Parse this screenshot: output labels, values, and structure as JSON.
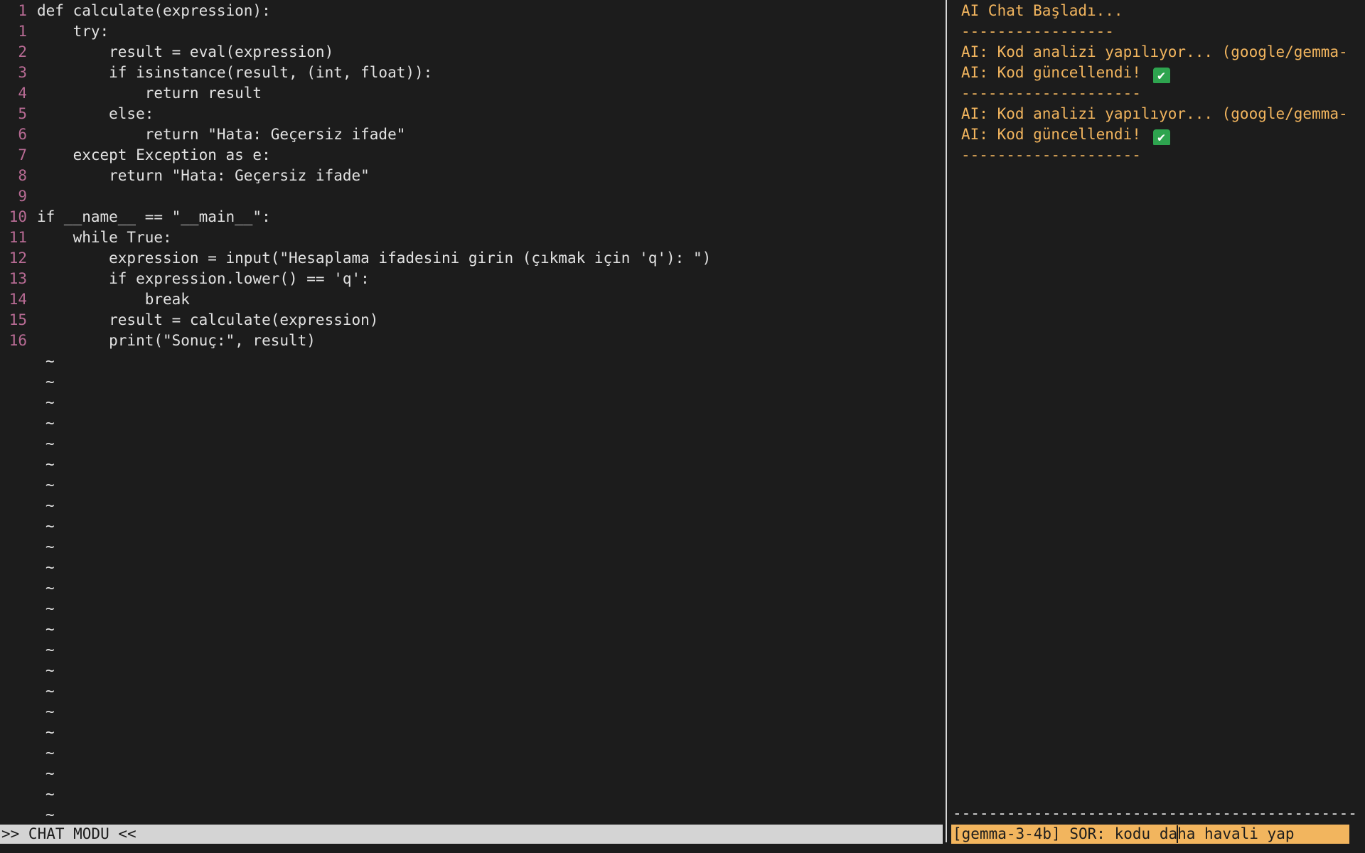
{
  "editor": {
    "lines": [
      {
        "num": "1",
        "code": "def calculate(expression):"
      },
      {
        "num": "1",
        "code": "    try:"
      },
      {
        "num": "2",
        "code": "        result = eval(expression)"
      },
      {
        "num": "3",
        "code": "        if isinstance(result, (int, float)):"
      },
      {
        "num": "4",
        "code": "            return result"
      },
      {
        "num": "5",
        "code": "        else:"
      },
      {
        "num": "6",
        "code": "            return \"Hata: Geçersiz ifade\""
      },
      {
        "num": "7",
        "code": "    except Exception as e:"
      },
      {
        "num": "8",
        "code": "        return \"Hata: Geçersiz ifade\""
      },
      {
        "num": "9",
        "code": ""
      },
      {
        "num": "10",
        "code": "if __name__ == \"__main__\":"
      },
      {
        "num": "11",
        "code": "    while True:"
      },
      {
        "num": "12",
        "code": "        expression = input(\"Hesaplama ifadesini girin (çıkmak için 'q'): \")"
      },
      {
        "num": "13",
        "code": "        if expression.lower() == 'q':"
      },
      {
        "num": "14",
        "code": "            break"
      },
      {
        "num": "15",
        "code": "        result = calculate(expression)"
      },
      {
        "num": "16",
        "code": "        print(\"Sonuç:\", result)"
      }
    ],
    "tilde_marker": "~",
    "empty_rows": 23
  },
  "chat": {
    "log": [
      {
        "text": "AI Chat Başladı...",
        "check": false
      },
      {
        "text": "-----------------",
        "check": false
      },
      {
        "text": "AI: Kod analizi yapılıyor... (google/gemma-",
        "check": false
      },
      {
        "text": "AI: Kod güncellendi!",
        "check": true
      },
      {
        "text": "--------------------",
        "check": false
      },
      {
        "text": "AI: Kod analizi yapılıyor... (google/gemma-",
        "check": false
      },
      {
        "text": "AI: Kod güncellendi!",
        "check": true
      },
      {
        "text": "--------------------",
        "check": false
      }
    ],
    "check_icon_glyph": "✔",
    "separator": "-------------------------------------------------------",
    "input": {
      "model_tag": "[gemma-3-4b]",
      "prompt_label": "SOR:",
      "value_before_cursor": "kodu da",
      "value_after_cursor": "ha havali yap"
    }
  },
  "status_bar": {
    "mode_text": ">> CHAT MODU <<"
  },
  "colors": {
    "background": "#1c1c1c",
    "code_text": "#e2e2e2",
    "line_numbers": "#b86b94",
    "chat_text": "#f2b55e",
    "status_bar_bg": "#d4d4d4",
    "input_bar_bg": "#f2b55e",
    "check_icon_bg": "#2ea44f"
  }
}
